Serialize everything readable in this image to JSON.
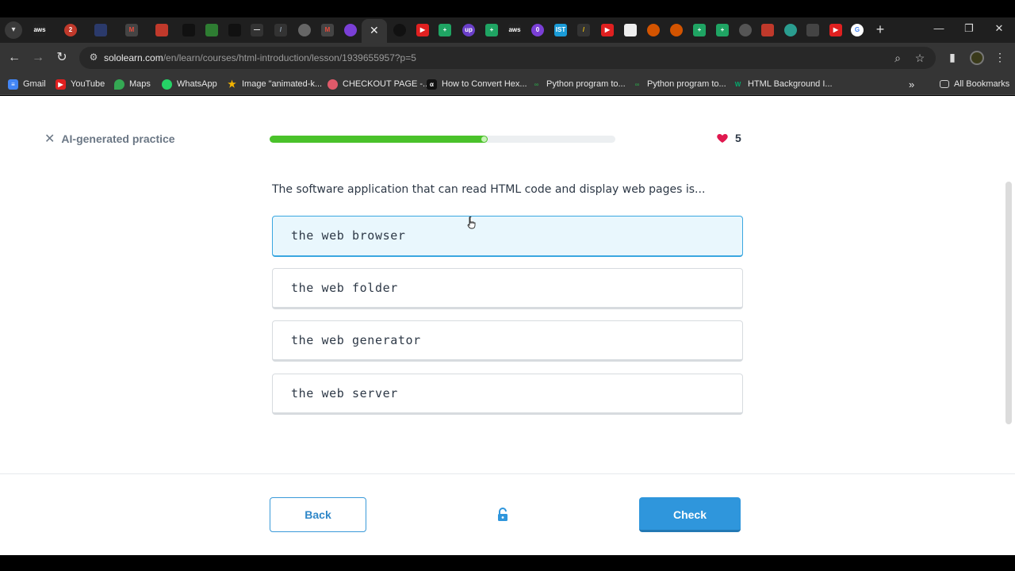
{
  "browser": {
    "url_host": "sololearn.com",
    "url_path": "/en/learn/courses/html-introduction/lesson/1939655957?p=5",
    "bookmarks": [
      {
        "label": "Gmail"
      },
      {
        "label": "YouTube"
      },
      {
        "label": "Maps"
      },
      {
        "label": "WhatsApp"
      },
      {
        "label": "Image \"animated-k..."
      },
      {
        "label": "CHECKOUT PAGE -..."
      },
      {
        "label": "How to Convert Hex..."
      },
      {
        "label": "Python program to..."
      },
      {
        "label": "Python program to..."
      },
      {
        "label": "HTML Background I..."
      }
    ],
    "all_bookmarks": "All Bookmarks"
  },
  "header": {
    "close_label": "AI-generated practice",
    "progress": 0.63,
    "hearts": "5"
  },
  "question": "The software application that can read HTML code and display web pages is...",
  "options": [
    {
      "text": "the web browser",
      "selected": true
    },
    {
      "text": "the web folder",
      "selected": false
    },
    {
      "text": "the web generator",
      "selected": false
    },
    {
      "text": "the web server",
      "selected": false
    }
  ],
  "footer": {
    "back_label": "Back",
    "check_label": "Check"
  },
  "colors": {
    "progress": "#4ac22a",
    "heart": "#e0184f",
    "primary": "#2f96dc"
  }
}
